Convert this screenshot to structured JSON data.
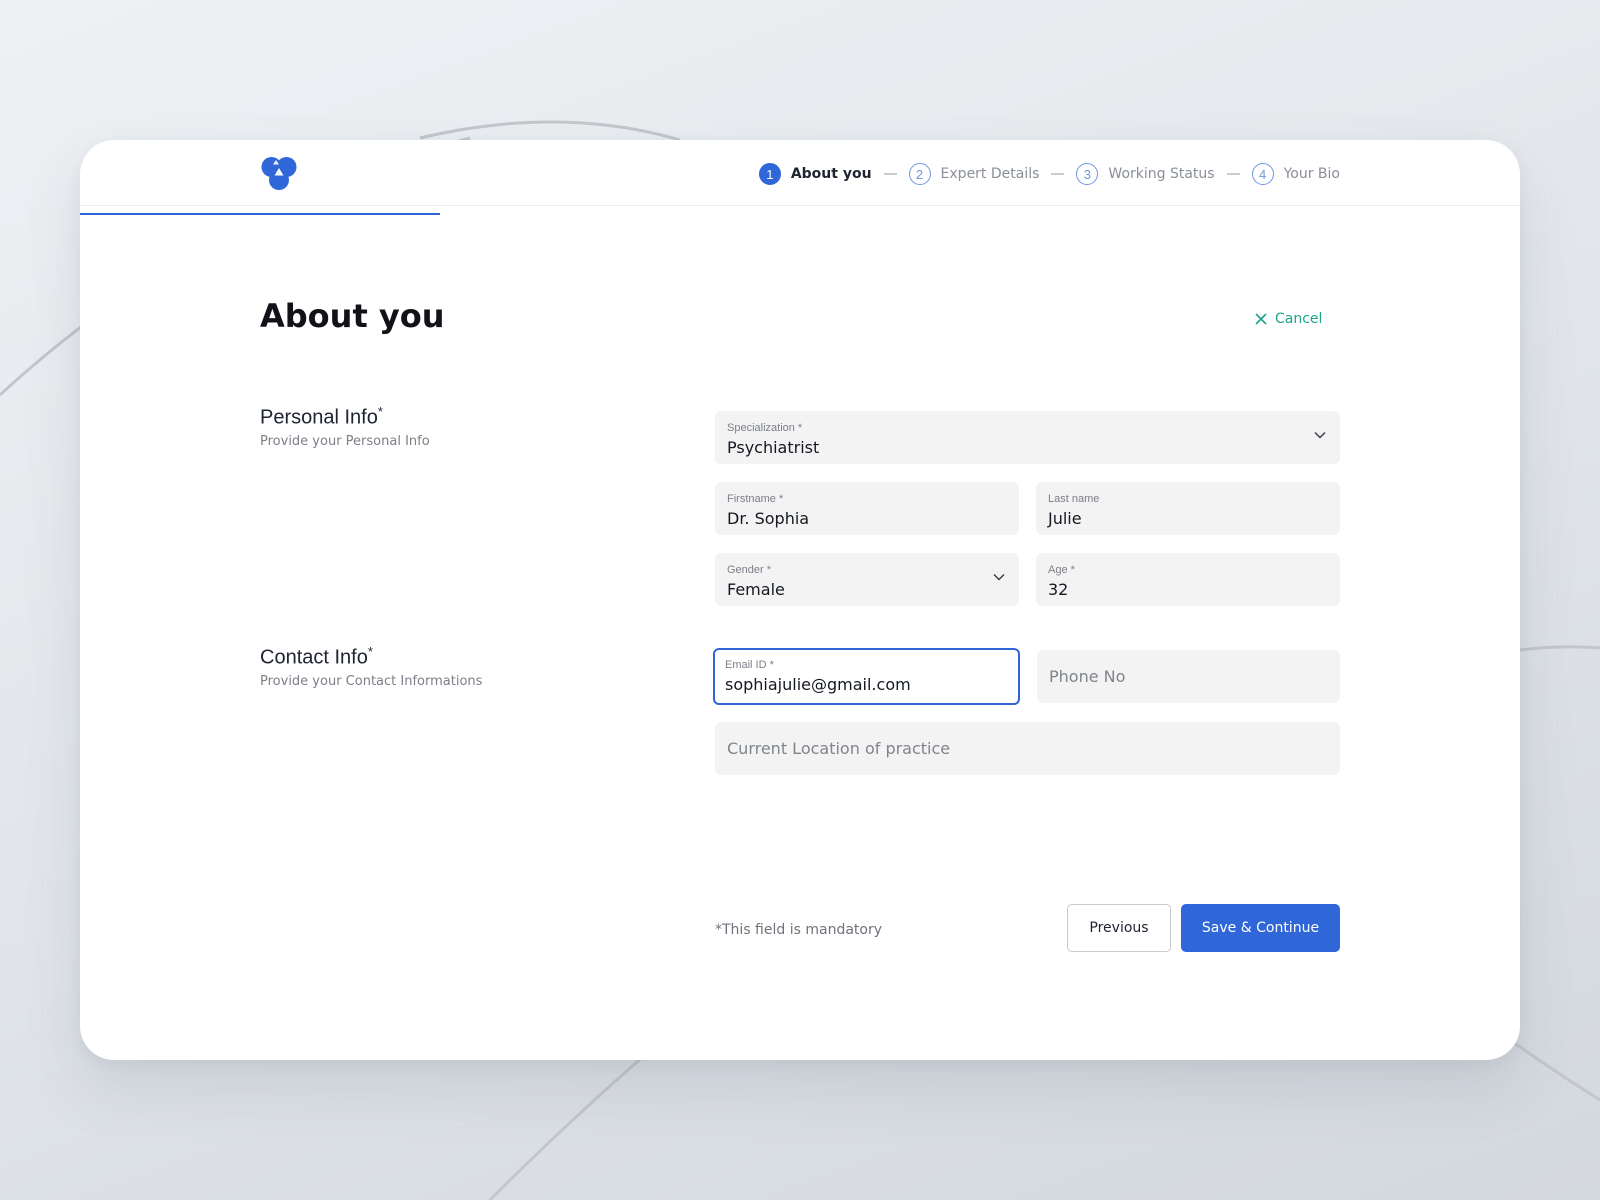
{
  "colors": {
    "accent": "#2f67d8",
    "cancel": "#1ca58a",
    "field_bg": "#f3f3f4"
  },
  "steps": [
    {
      "number": "1",
      "label": "About you",
      "active": true
    },
    {
      "number": "2",
      "label": "Expert Details",
      "active": false
    },
    {
      "number": "3",
      "label": "Working Status",
      "active": false
    },
    {
      "number": "4",
      "label": "Your Bio",
      "active": false
    }
  ],
  "page": {
    "title": "About you",
    "cancel_label": "Cancel"
  },
  "personal": {
    "title": "Personal Info",
    "asterisk": "*",
    "subtitle": "Provide your Personal Info",
    "specialization": {
      "label": "Specialization *",
      "value": "Psychiatrist"
    },
    "firstname": {
      "label": "Firstname *",
      "value": "Dr. Sophia"
    },
    "lastname": {
      "label": "Last name",
      "value": "Julie"
    },
    "gender": {
      "label": "Gender *",
      "value": "Female"
    },
    "age": {
      "label": "Age *",
      "value": "32"
    }
  },
  "contact": {
    "title": "Contact Info",
    "asterisk": "*",
    "subtitle": "Provide your Contact Informations",
    "email": {
      "label": "Email ID *",
      "value": "sophiajulie@gmail.com"
    },
    "phone": {
      "placeholder": "Phone No"
    },
    "location": {
      "placeholder": "Current Location of practice"
    }
  },
  "footer": {
    "mandatory_note": "*This field is mandatory",
    "previous_label": "Previous",
    "save_label": "Save & Continue"
  },
  "icons": {
    "logo": "logo-icon",
    "cancel": "close-icon",
    "dropdown": "chevron-down-icon"
  }
}
